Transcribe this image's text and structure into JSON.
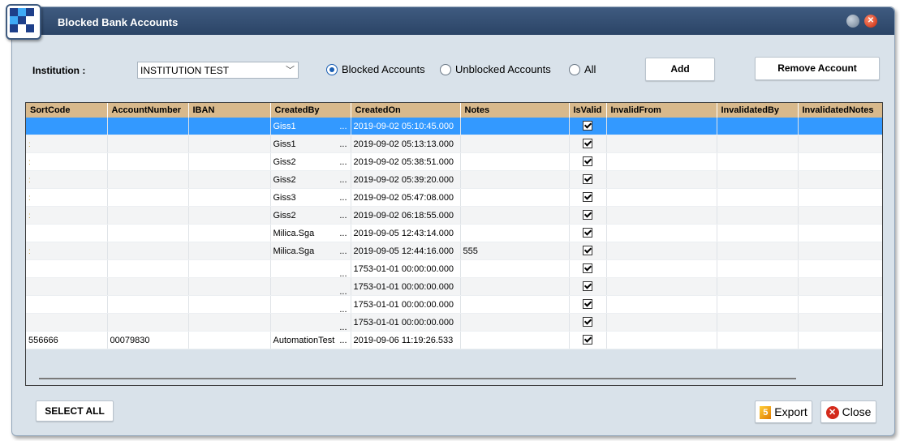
{
  "window": {
    "title": "Blocked Bank Accounts"
  },
  "filter": {
    "institution_label": "Institution :",
    "institution_value": "INSTITUTION TEST",
    "radios": [
      {
        "label": "Blocked Accounts",
        "checked": true
      },
      {
        "label": "Unblocked Accounts",
        "checked": false
      },
      {
        "label": "All",
        "checked": false
      }
    ],
    "add_label": "Add",
    "remove_label": "Remove Account"
  },
  "grid": {
    "columns": [
      "SortCode",
      "AccountNumber",
      "IBAN",
      "CreatedBy",
      "CreatedOn",
      "Notes",
      "IsValid",
      "InvalidFrom",
      "InvalidatedBy",
      "InvalidatedNotes"
    ],
    "rows": [
      {
        "sortcode": "",
        "account": "",
        "iban": "",
        "createdby": "Giss1",
        "createdon": "2019-09-02 05:10:45.000",
        "notes": "",
        "selected": true
      },
      {
        "sortcode": ":",
        "account": "",
        "iban": "",
        "createdby": "Giss1",
        "createdon": "2019-09-02 05:13:13.000",
        "notes": ""
      },
      {
        "sortcode": ":",
        "account": "",
        "iban": "",
        "createdby": "Giss2",
        "createdon": "2019-09-02 05:38:51.000",
        "notes": ""
      },
      {
        "sortcode": ":",
        "account": "",
        "iban": "",
        "createdby": "Giss2",
        "createdon": "2019-09-02 05:39:20.000",
        "notes": ""
      },
      {
        "sortcode": ":",
        "account": "",
        "iban": "",
        "createdby": "Giss3",
        "createdon": "2019-09-02 05:47:08.000",
        "notes": ""
      },
      {
        "sortcode": ":",
        "account": "",
        "iban": "",
        "createdby": "Giss2",
        "createdon": "2019-09-02 06:18:55.000",
        "notes": ""
      },
      {
        "sortcode": "",
        "account": "",
        "iban": "",
        "createdby": "Milica.Sga",
        "createdon": "2019-09-05 12:43:14.000",
        "notes": ""
      },
      {
        "sortcode": ":",
        "account": "",
        "iban": "",
        "createdby": "Milica.Sga",
        "createdon": "2019-09-05 12:44:16.000",
        "notes": "555"
      },
      {
        "sortcode": "",
        "account": "",
        "iban": "",
        "createdby": "",
        "createdon": "1753-01-01 00:00:00.000",
        "notes": ""
      },
      {
        "sortcode": "",
        "account": "",
        "iban": "",
        "createdby": "",
        "createdon": "1753-01-01 00:00:00.000",
        "notes": ""
      },
      {
        "sortcode": "",
        "account": "",
        "iban": "",
        "createdby": "",
        "createdon": "1753-01-01 00:00:00.000",
        "notes": ""
      },
      {
        "sortcode": "",
        "account": "",
        "iban": "",
        "createdby": "",
        "createdon": "1753-01-01 00:00:00.000",
        "notes": ""
      },
      {
        "sortcode": "556666",
        "account": "00079830",
        "iban": "",
        "createdby": "AutomationTest",
        "createdon": "2019-09-06 11:19:26.533",
        "notes": ""
      }
    ],
    "ellipsis": "..."
  },
  "footer": {
    "select_all_label": "SELECT ALL",
    "export_label": "Export",
    "close_label": "Close"
  },
  "colors": {
    "header": "#d8b98c",
    "selection": "#3399ff",
    "titlebar": "#2b4466"
  }
}
